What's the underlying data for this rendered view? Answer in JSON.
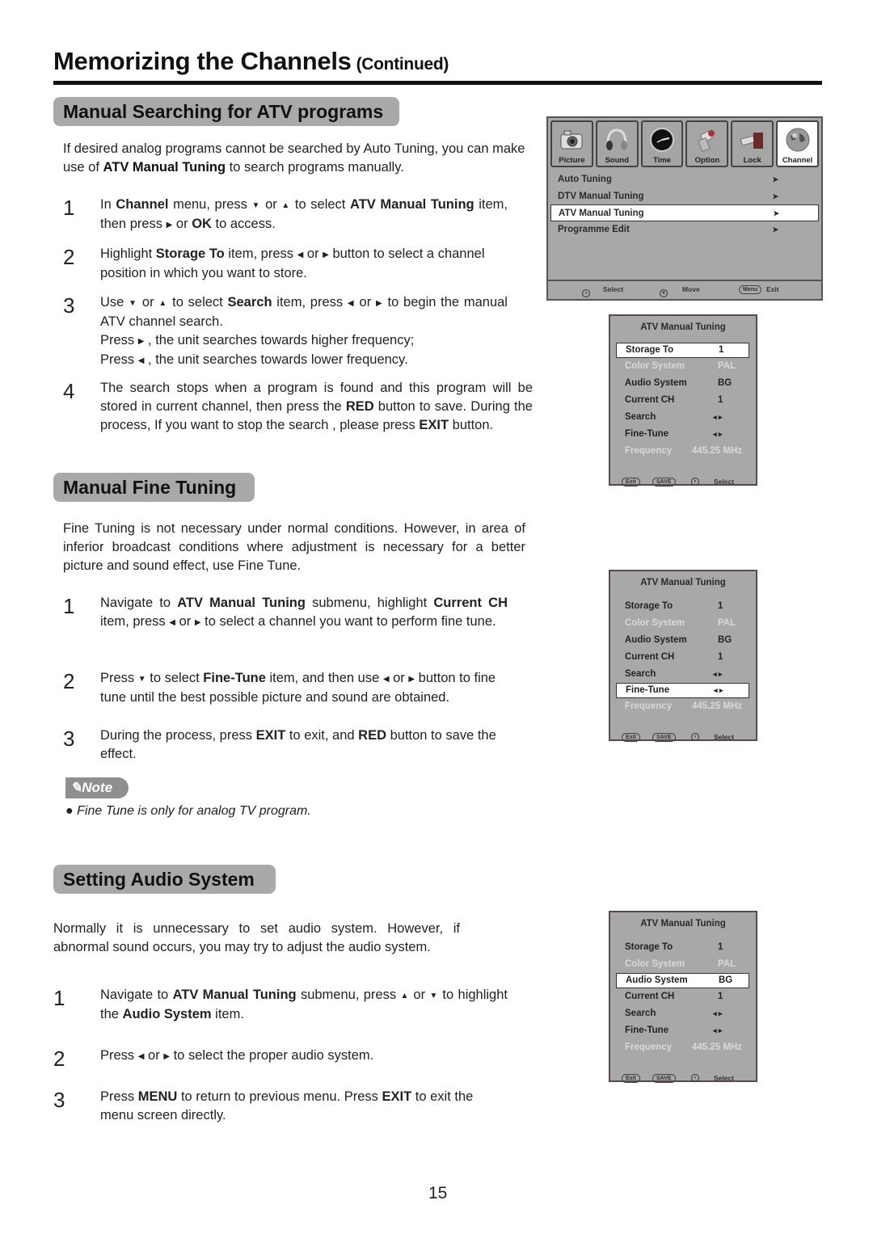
{
  "header": {
    "title": "Memorizing the Channels",
    "continued": "(Continued)"
  },
  "sections": {
    "manual_search": {
      "heading": "Manual Searching for ATV programs",
      "intro_pre": "If desired analog programs cannot be searched by Auto Tuning, you can make use of ",
      "intro_bold": "ATV Manual Tuning",
      "intro_post": " to search programs manually.",
      "steps": [
        {
          "num": "1",
          "parts": [
            {
              "t": "In "
            },
            {
              "b": "Channel"
            },
            {
              "t": " menu,   press "
            },
            {
              "i": "down"
            },
            {
              "t": " or "
            },
            {
              "i": "up"
            },
            {
              "t": "  to select "
            },
            {
              "b": "ATV Manual Tuning"
            },
            {
              "t": " item, then press "
            },
            {
              "i": "right"
            },
            {
              "t": " or "
            },
            {
              "b": "OK"
            },
            {
              "t": " to access."
            }
          ]
        },
        {
          "num": "2",
          "parts": [
            {
              "t": "Highlight "
            },
            {
              "b": "Storage To"
            },
            {
              "t": " item, press "
            },
            {
              "i": "left"
            },
            {
              "t": " or "
            },
            {
              "i": "right"
            },
            {
              "t": " button to select a channel position in which you want to store."
            }
          ]
        },
        {
          "num": "3",
          "parts": [
            {
              "t": "Use "
            },
            {
              "i": "down"
            },
            {
              "t": " or "
            },
            {
              "i": "up"
            },
            {
              "t": "  to select "
            },
            {
              "b": "Search"
            },
            {
              "t": " item, press "
            },
            {
              "i": "left"
            },
            {
              "t": " or "
            },
            {
              "i": "right"
            },
            {
              "t": " to begin the manual ATV channel search."
            },
            {
              "br": true
            },
            {
              "t": "Press  "
            },
            {
              "i": "right"
            },
            {
              "t": " , the unit searches towards higher frequency;"
            },
            {
              "br": true
            },
            {
              "t": "Press  "
            },
            {
              "i": "left"
            },
            {
              "t": " , the unit searches towards lower frequency."
            }
          ]
        },
        {
          "num": "4",
          "parts": [
            {
              "t": "The search stops when a program is found and this program will be stored in current channel, then press the "
            },
            {
              "b": "RED"
            },
            {
              "t": " button to save. During the process, If you want to stop the search , please press "
            },
            {
              "b": "EXIT"
            },
            {
              "t": " button."
            }
          ]
        }
      ]
    },
    "fine_tuning": {
      "heading": "Manual Fine Tuning",
      "intro": "Fine Tuning is not necessary under normal conditions. However, in area of inferior broadcast conditions where adjustment is necessary for a better picture and sound effect, use Fine Tune.",
      "steps": [
        {
          "num": "1",
          "parts": [
            {
              "t": "Navigate to "
            },
            {
              "b": "ATV Manual Tuning"
            },
            {
              "t": " submenu,  highlight "
            },
            {
              "b": "Current CH"
            },
            {
              "t": " item, press "
            },
            {
              "i": "left"
            },
            {
              "t": " or "
            },
            {
              "i": "right"
            },
            {
              "t": " to select a channel you want to perform fine tune."
            }
          ]
        },
        {
          "num": "2",
          "parts": [
            {
              "t": "Press "
            },
            {
              "i": "down"
            },
            {
              "t": " to select "
            },
            {
              "b": "Fine-Tune"
            },
            {
              "t": " item, and then use "
            },
            {
              "i": "left"
            },
            {
              "t": " or "
            },
            {
              "i": "right"
            },
            {
              "t": " button to fine tune until the best possible picture and sound are obtained."
            }
          ]
        },
        {
          "num": "3",
          "parts": [
            {
              "t": "During the process, press "
            },
            {
              "b": "EXIT"
            },
            {
              "t": " to exit, and "
            },
            {
              "b": "RED"
            },
            {
              "t": " button to save the effect."
            }
          ]
        }
      ],
      "note": {
        "label": "Note",
        "bullet": "Fine Tune is only for analog TV program."
      }
    },
    "audio_system": {
      "heading": "Setting Audio System",
      "intro": "Normally it is unnecessary to set audio system. However, if abnormal sound occurs, you may try to adjust the audio system.",
      "steps": [
        {
          "num": "1",
          "parts": [
            {
              "t": "Navigate to "
            },
            {
              "b": "ATV Manual Tuning"
            },
            {
              "t": " submenu, press "
            },
            {
              "i": "up"
            },
            {
              "t": " or "
            },
            {
              "i": "down"
            },
            {
              "t": "  to highlight the "
            },
            {
              "b": "Audio System"
            },
            {
              "t": " item."
            }
          ]
        },
        {
          "num": "2",
          "parts": [
            {
              "t": "Press "
            },
            {
              "i": "left"
            },
            {
              "t": " or "
            },
            {
              "i": "right"
            },
            {
              "t": " to select the proper audio system."
            }
          ]
        },
        {
          "num": "3",
          "parts": [
            {
              "t": "Press "
            },
            {
              "b": "MENU"
            },
            {
              "t": " to return to previous menu. Press "
            },
            {
              "b": "EXIT"
            },
            {
              "t": " to exit the menu screen directly."
            }
          ]
        }
      ]
    }
  },
  "osd_main": {
    "tabs": [
      {
        "label": "Picture",
        "icon": "camera-icon",
        "active": false
      },
      {
        "label": "Sound",
        "icon": "headphones-icon",
        "active": false
      },
      {
        "label": "Time",
        "icon": "clock-icon",
        "active": false
      },
      {
        "label": "Option",
        "icon": "gear-shaft-icon",
        "active": false
      },
      {
        "label": "Lock",
        "icon": "lock-icon",
        "active": false
      },
      {
        "label": "Channel",
        "icon": "globe-icon",
        "active": true
      }
    ],
    "items": [
      {
        "label": "Auto Tuning",
        "selected": false
      },
      {
        "label": "DTV Manual Tuning",
        "selected": false
      },
      {
        "label": "ATV Manual Tuning",
        "selected": true
      },
      {
        "label": "Programme Edit",
        "selected": false
      }
    ],
    "footer": {
      "select": "Select",
      "move": "Move",
      "menu_key": "Menu",
      "exit": "Exit"
    }
  },
  "atv_panel": {
    "title": "ATV Manual Tuning",
    "rows": [
      {
        "label": "Storage To",
        "value": "1",
        "dim": false
      },
      {
        "label": "Color System",
        "value": "PAL",
        "dim": true
      },
      {
        "label": "Audio System",
        "value": "BG",
        "dim": false
      },
      {
        "label": "Current CH",
        "value": "1",
        "dim": false
      },
      {
        "label": "Search",
        "value": "◂  ▸",
        "dim": false
      },
      {
        "label": "Fine-Tune",
        "value": "◂  ▸",
        "dim": false
      },
      {
        "label": "Frequency",
        "value": "445.25 MHz",
        "dim": true
      }
    ],
    "footer": {
      "exit": "Exit",
      "save": "SAVE",
      "select": "Select"
    },
    "panels_selected_row": [
      "Storage To",
      "Fine-Tune",
      "Audio System"
    ]
  },
  "page_number": "15",
  "colors": {
    "heading_bg": "#a9a9a9",
    "osd_bg": "#a8a8a8",
    "highlight": "#ffffff",
    "note_bg": "#8f8f8f"
  }
}
